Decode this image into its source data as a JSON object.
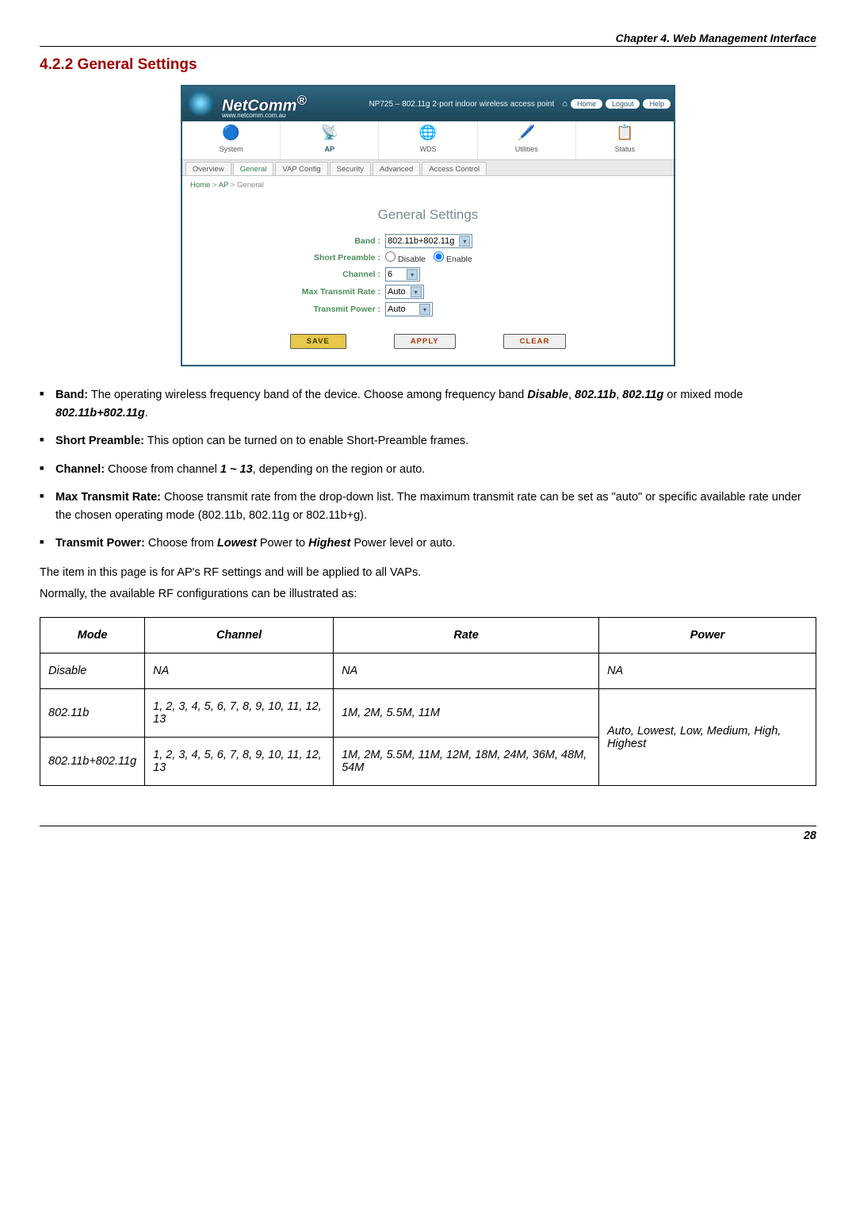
{
  "chapter": {
    "header": "Chapter 4. Web Management Interface"
  },
  "section": {
    "number_title": "4.2.2  General Settings"
  },
  "figure": {
    "brand": "NetComm",
    "brand_sup": "®",
    "brand_sub": "www.netcomm.com.au",
    "device_desc": "NP725 – 802.11g 2-port indoor wireless access point",
    "top_links": {
      "home": "Home",
      "logout": "Logout",
      "help": "Help"
    },
    "nav": [
      {
        "label": "System",
        "icon": "🔵"
      },
      {
        "label": "AP",
        "icon": "📡",
        "active": true
      },
      {
        "label": "WDS",
        "icon": "🌐"
      },
      {
        "label": "Utilities",
        "icon": "🖊️"
      },
      {
        "label": "Status",
        "icon": "📋"
      }
    ],
    "tabs": [
      "Overview",
      "General",
      "VAP Config",
      "Security",
      "Advanced",
      "Access Control"
    ],
    "active_tab": "General",
    "breadcrumb": {
      "home": "Home",
      "mid": "AP",
      "leaf": "General",
      "sep": ">"
    },
    "panel_title": "General Settings",
    "fields": {
      "band": {
        "label": "Band :",
        "value": "802.11b+802.11g"
      },
      "preamble": {
        "label": "Short Preamble :",
        "opt_disable": "Disable",
        "opt_enable": "Enable",
        "selected": "Enable"
      },
      "channel": {
        "label": "Channel :",
        "value": "6"
      },
      "maxrate": {
        "label": "Max Transmit Rate :",
        "value": "Auto"
      },
      "txpower": {
        "label": "Transmit Power :",
        "value": "Auto"
      }
    },
    "buttons": {
      "save": "SAVE",
      "apply": "APPLY",
      "clear": "CLEAR"
    }
  },
  "bullets": {
    "band": {
      "lead": "Band:",
      "t1": " The operating wireless frequency band of the device. Choose among frequency band ",
      "opt_disable": "Disable",
      "comma1": ", ",
      "opt_b": "802.11b",
      "comma2": ", ",
      "opt_g": "802.11g",
      "t2": " or mixed mode ",
      "opt_bg": "802.11b+802.11g",
      "tail": "."
    },
    "preamble": {
      "lead": "Short Preamble:",
      "text": " This option can be turned on to enable Short-Preamble frames."
    },
    "channel": {
      "lead": "Channel:",
      "t1": " Choose from channel ",
      "range": "1 ~ 13",
      "t2": ", depending on the region or auto."
    },
    "maxrate": {
      "lead": "Max Transmit Rate:",
      "text": " Choose transmit rate from the drop-down list. The maximum transmit rate can be set as \"auto\" or specific available rate under the chosen operating mode (802.11b, 802.11g or 802.11b+g)."
    },
    "txpower": {
      "lead": "Transmit Power:",
      "t1": " Choose from ",
      "low": "Lowest",
      "t2": " Power to ",
      "high": "Highest",
      "t3": " Power level or auto."
    }
  },
  "para1": "The item in this page is for AP's RF settings and will be applied to all VAPs.",
  "para2": "Normally, the available RF configurations can be illustrated as:",
  "table": {
    "headers": [
      "Mode",
      "Channel",
      "Rate",
      "Power"
    ],
    "rows": [
      {
        "mode": "Disable",
        "channel": "NA",
        "rate": "NA",
        "power": "NA"
      },
      {
        "mode": "802.11b",
        "channel": "1, 2, 3, 4, 5, 6, 7, 8, 9, 10, 11, 12, 13",
        "rate": "1M, 2M, 5.5M, 11M"
      },
      {
        "mode": "802.11b+802.11g",
        "channel": "1, 2, 3, 4, 5, 6, 7, 8, 9, 10, 11, 12, 13",
        "rate": "1M, 2M, 5.5M, 11M, 12M, 18M, 24M, 36M, 48M, 54M"
      }
    ],
    "power_merged": "Auto, Lowest, Low, Medium, High, Highest"
  },
  "page_number": "28"
}
